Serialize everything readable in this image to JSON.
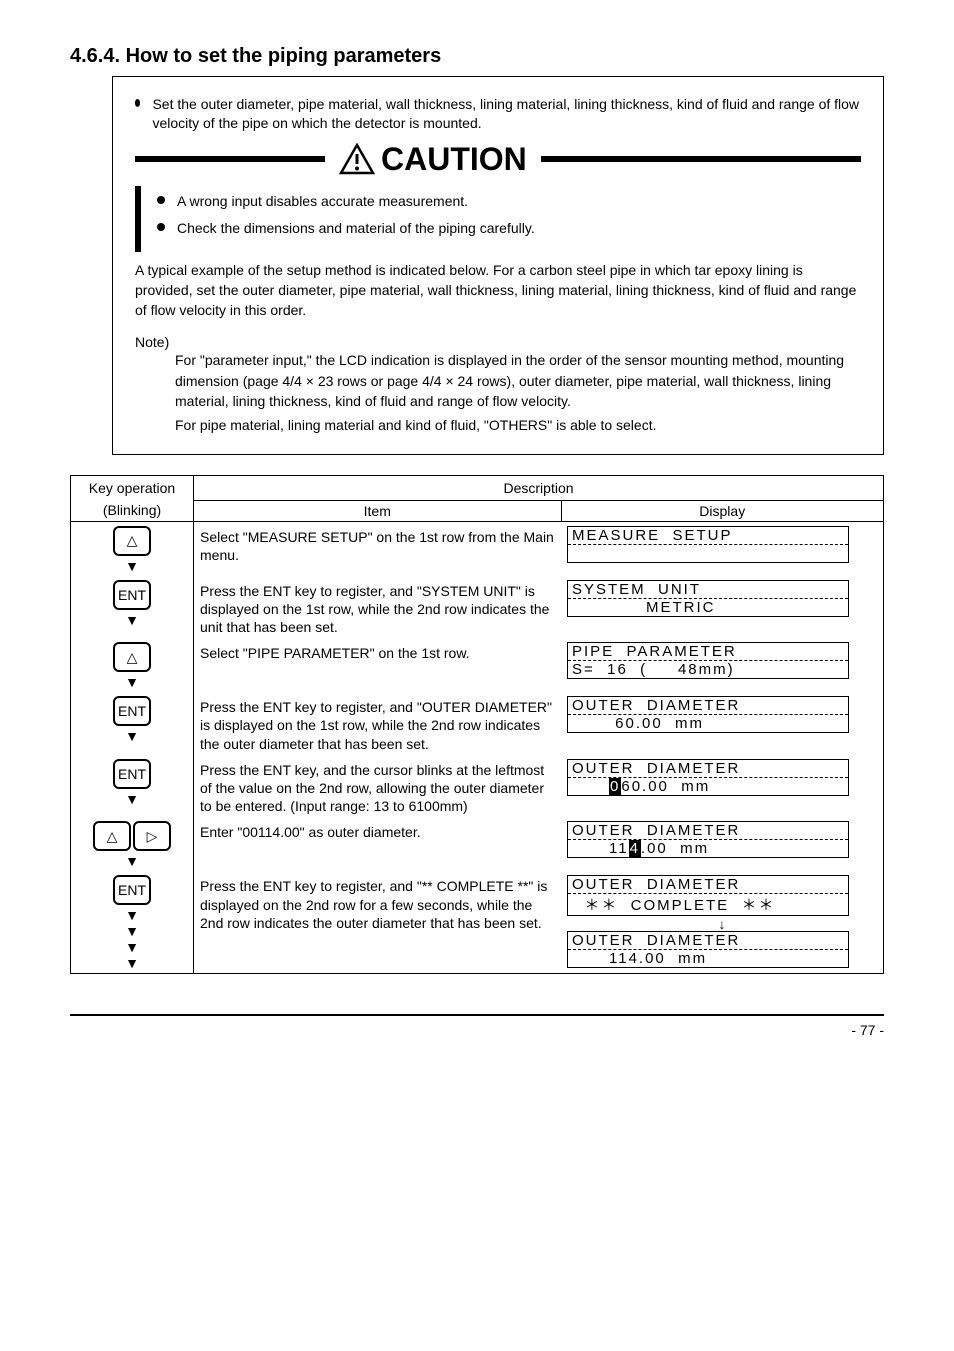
{
  "section_number": "4.6.4.",
  "section_title": "How to set the piping parameters",
  "description": "Set the outer diameter, pipe material, wall thickness, lining material, lining thickness, kind of fluid and range of flow velocity of the pipe on which the detector is mounted.",
  "caution_label": "CAUTION",
  "caution_items": [
    "A wrong input disables accurate measurement.",
    "Check the dimensions and material of the piping carefully."
  ],
  "intro_para": "A typical example of the setup method is indicated below. For a carbon steel pipe in which tar epoxy lining is provided, set the outer diameter, pipe material, wall thickness, lining material, lining thickness, kind of fluid and range of flow velocity in this order.",
  "note_label": "Note)",
  "note_bullets": [
    "For \"parameter input,\" the LCD indication is displayed in the order of the sensor mounting method, mounting dimension (page 4/4 × 23 rows or page 4/4 × 24 rows), outer diameter, pipe material, wall thickness, lining material, lining thickness, kind of fluid and range of flow velocity.",
    "For pipe material, lining material and kind of fluid, \"OTHERS\" is able to select."
  ],
  "table_header_left": "Key operation",
  "table_header_right": "Description",
  "table_sub_left": "(Blinking)",
  "table_sub_right_item": "Item",
  "table_sub_right_disp": "Display",
  "rows": [
    {
      "keys": [
        "up"
      ],
      "item": "Select \"MEASURE SETUP\" on the 1st row from the Main menu.",
      "disp_l1": "MEASURE  SETUP",
      "disp_l2": ""
    },
    {
      "keys": [
        "ent"
      ],
      "item": "Press the ENT key to register, and \"SYSTEM UNIT\" is displayed on the 1st row, while the 2nd row indicates the unit that has been set.",
      "disp_l1": "SYSTEM  UNIT",
      "disp_l2": "            METRIC"
    },
    {
      "keys": [
        "up"
      ],
      "item": "Select \"PIPE PARAMETER\" on the 1st row.",
      "disp_l1": "PIPE  PARAMETER",
      "disp_l2": "S=  16  (     48mm)"
    },
    {
      "keys": [
        "ent"
      ],
      "item": "Press the ENT key to register, and \"OUTER DIAMETER\" is displayed on the 1st row, while the 2nd row indicates the outer diameter that has been set.",
      "disp_l1": "OUTER  DIAMETER",
      "disp_l2": "       60.00  mm"
    },
    {
      "keys": [
        "ent"
      ],
      "item": "Press the ENT key, and the cursor blinks at the leftmost of the value on the 2nd row, allowing the outer diameter to be entered. (Input range: 13 to 6100mm)",
      "disp_l1": "OUTER  DIAMETER",
      "disp_l2_pre": "      ",
      "disp_l2_inv": "0",
      "disp_l2_post": "60.00  mm"
    },
    {
      "keys": [
        "up",
        "right"
      ],
      "item": "Enter \"00114.00\" as outer diameter.",
      "disp_l1": "OUTER  DIAMETER",
      "disp_l2_pre": "      11",
      "disp_l2_inv": "4",
      "disp_l2_post": ".00  mm"
    },
    {
      "keys": [
        "ent"
      ],
      "item": "Press the ENT key to register, and \"** COMPLETE **\" is displayed on the 2nd row for a few seconds, while the 2nd row indicates the outer diameter that has been set.",
      "disp_double": true,
      "disp_l1": "OUTER  DIAMETER",
      "disp_l2": "  ＊＊  COMPLETE  ＊＊",
      "disp_mid": "↓",
      "disp2_l1": "OUTER  DIAMETER",
      "disp2_l2": "      114.00  mm"
    }
  ],
  "footer_left": "",
  "footer_right": "- 77 -"
}
